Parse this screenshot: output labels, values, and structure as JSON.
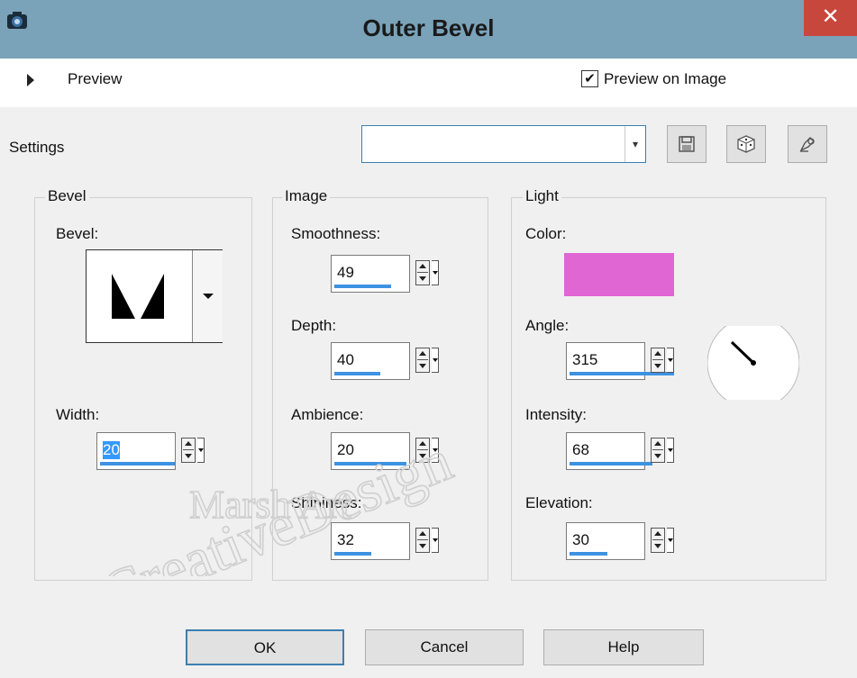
{
  "window": {
    "title": "Outer Bevel",
    "close_glyph": "✕",
    "app_icon": "camera-app-icon"
  },
  "preview": {
    "label": "Preview",
    "preview_on_image_label": "Preview on Image",
    "preview_on_image_checked": true,
    "check_glyph": "✔"
  },
  "settings": {
    "label": "Settings",
    "selected": "",
    "dropdown_glyph": "▾",
    "save_icon": "save-icon",
    "randomize_icon": "dice-icon",
    "reset_icon": "reset-icon"
  },
  "bevel_group": {
    "title": "Bevel",
    "bevel_label": "Bevel:",
    "width_label": "Width:",
    "width_value": "20"
  },
  "image_group": {
    "title": "Image",
    "smoothness_label": "Smoothness:",
    "smoothness_value": "49",
    "depth_label": "Depth:",
    "depth_value": "40",
    "ambience_label": "Ambience:",
    "ambience_value": "20",
    "shininess_label": "Shininess:",
    "shininess_value": "32"
  },
  "light_group": {
    "title": "Light",
    "color_label": "Color:",
    "color": "#e066d4",
    "angle_label": "Angle:",
    "angle_value": "315",
    "intensity_label": "Intensity:",
    "intensity_value": "68",
    "elevation_label": "Elevation:",
    "elevation_value": "30"
  },
  "buttons": {
    "ok": "OK",
    "cancel": "Cancel",
    "help": "Help"
  },
  "watermark": {
    "line1": "CreativeDesign",
    "line2": "Marsh Art"
  }
}
